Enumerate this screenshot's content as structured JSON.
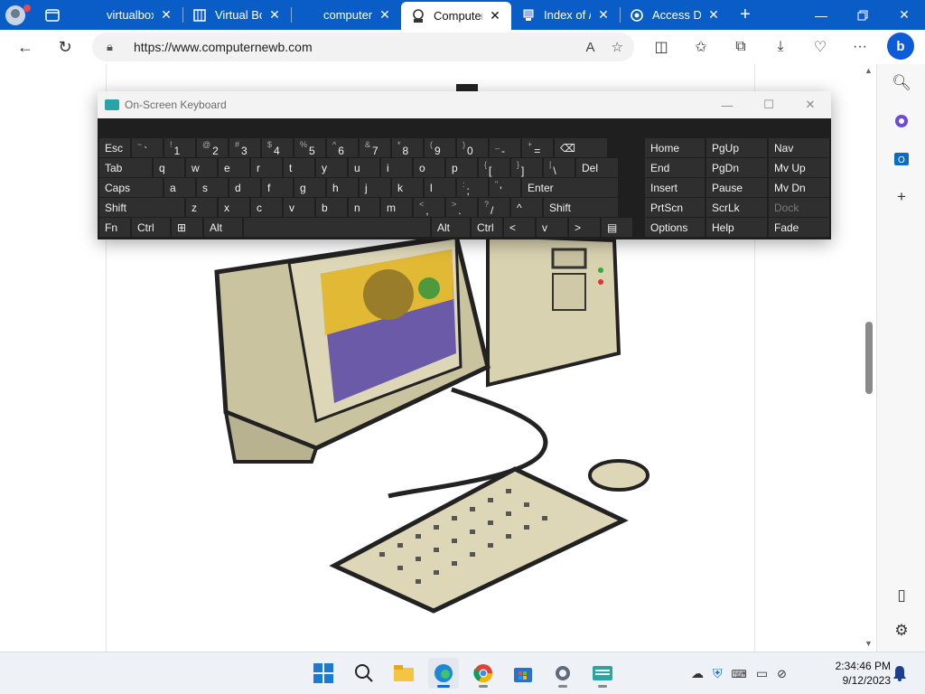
{
  "browser": {
    "tabs": [
      {
        "label": "virtualbox",
        "icon": "edge-tab-icon"
      },
      {
        "label": "Virtual Bo",
        "icon": "book-icon"
      },
      {
        "label": "computer",
        "icon": "none"
      },
      {
        "label": "Computer",
        "icon": "computer-nerd-icon"
      },
      {
        "label": "Index of /",
        "icon": "pc-icon"
      },
      {
        "label": "Access De",
        "icon": "shield-icon"
      }
    ],
    "active_tab_index": 3,
    "url": "https://www.computernewb.com"
  },
  "osk": {
    "title": "On-Screen Keyboard",
    "rows": [
      [
        {
          "label": "Esc"
        },
        {
          "sub": "~",
          "label": "`"
        },
        {
          "sub": "!",
          "label": "1"
        },
        {
          "sub": "@",
          "label": "2"
        },
        {
          "sub": "#",
          "label": "3"
        },
        {
          "sub": "$",
          "label": "4"
        },
        {
          "sub": "%",
          "label": "5"
        },
        {
          "sub": "^",
          "label": "6"
        },
        {
          "sub": "&",
          "label": "7"
        },
        {
          "sub": "*",
          "label": "8"
        },
        {
          "sub": "(",
          "label": "9"
        },
        {
          "sub": ")",
          "label": "0"
        },
        {
          "sub": "_",
          "label": "-"
        },
        {
          "sub": "+",
          "label": "="
        },
        {
          "label": "⌫"
        }
      ],
      [
        {
          "label": "Tab"
        },
        {
          "label": "q"
        },
        {
          "label": "w"
        },
        {
          "label": "e"
        },
        {
          "label": "r"
        },
        {
          "label": "t"
        },
        {
          "label": "y"
        },
        {
          "label": "u"
        },
        {
          "label": "i"
        },
        {
          "label": "o"
        },
        {
          "label": "p"
        },
        {
          "sub": "{",
          "label": "["
        },
        {
          "sub": "}",
          "label": "]"
        },
        {
          "sub": "|",
          "label": "\\"
        },
        {
          "label": "Del"
        }
      ],
      [
        {
          "label": "Caps"
        },
        {
          "label": "a"
        },
        {
          "label": "s"
        },
        {
          "label": "d"
        },
        {
          "label": "f"
        },
        {
          "label": "g"
        },
        {
          "label": "h"
        },
        {
          "label": "j"
        },
        {
          "label": "k"
        },
        {
          "label": "l"
        },
        {
          "sub": ":",
          "label": ";"
        },
        {
          "sub": "\"",
          "label": "'"
        },
        {
          "label": "Enter"
        }
      ],
      [
        {
          "label": "Shift"
        },
        {
          "label": "z"
        },
        {
          "label": "x"
        },
        {
          "label": "c"
        },
        {
          "label": "v"
        },
        {
          "label": "b"
        },
        {
          "label": "n"
        },
        {
          "label": "m"
        },
        {
          "sub": "<",
          "label": ","
        },
        {
          "sub": ">",
          "label": "."
        },
        {
          "sub": "?",
          "label": "/"
        },
        {
          "label": "^"
        },
        {
          "label": "Shift"
        }
      ],
      [
        {
          "label": "Fn"
        },
        {
          "label": "Ctrl"
        },
        {
          "label": "⊞"
        },
        {
          "label": "Alt"
        },
        {
          "label": ""
        },
        {
          "label": "Alt"
        },
        {
          "label": "Ctrl"
        },
        {
          "label": "<"
        },
        {
          "label": "v"
        },
        {
          "label": ">"
        },
        {
          "label": "▤"
        }
      ]
    ],
    "nav_keys": [
      [
        "Home",
        "PgUp",
        "Nav"
      ],
      [
        "End",
        "PgDn",
        "Mv Up"
      ],
      [
        "Insert",
        "Pause",
        "Mv Dn"
      ],
      [
        "PrtScn",
        "ScrLk",
        "Dock"
      ],
      [
        "Options",
        "Help",
        "Fade"
      ]
    ]
  },
  "taskbar": {
    "time": "2:34:46 PM",
    "date": "9/12/2023",
    "apps": [
      "start-icon",
      "search-icon",
      "file-explorer-icon",
      "edge-icon",
      "chrome-icon",
      "store-icon",
      "settings-icon",
      "osk-icon"
    ]
  }
}
